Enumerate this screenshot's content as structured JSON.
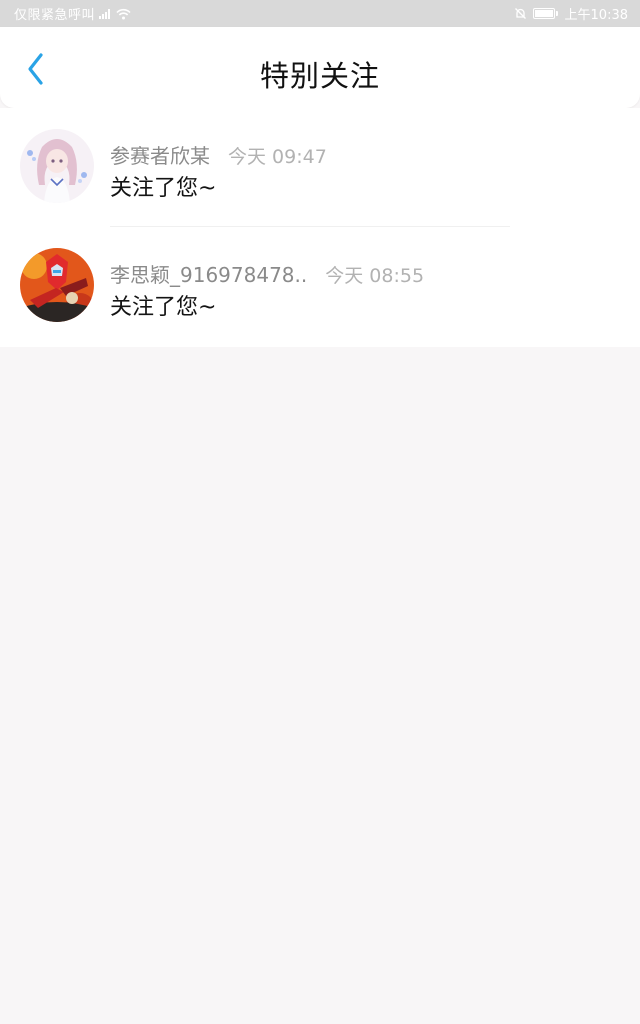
{
  "status_bar": {
    "carrier": "仅限紧急呼叫",
    "time": "上午10:38",
    "icons": [
      "signal-icon",
      "wifi-icon",
      "mute-icon",
      "battery-icon"
    ]
  },
  "nav": {
    "title": "特别关注",
    "back_icon": "chevron-left-icon",
    "accent_color": "#2aa3e6"
  },
  "items": [
    {
      "name": "参赛者欣某",
      "time": "今天 09:47",
      "message": "关注了您~",
      "avatar": "avatar-anime-girl"
    },
    {
      "name": "李思颖_916978478..",
      "time": "今天 08:55",
      "message": "关注了您~",
      "avatar": "avatar-robot-mecha"
    }
  ]
}
